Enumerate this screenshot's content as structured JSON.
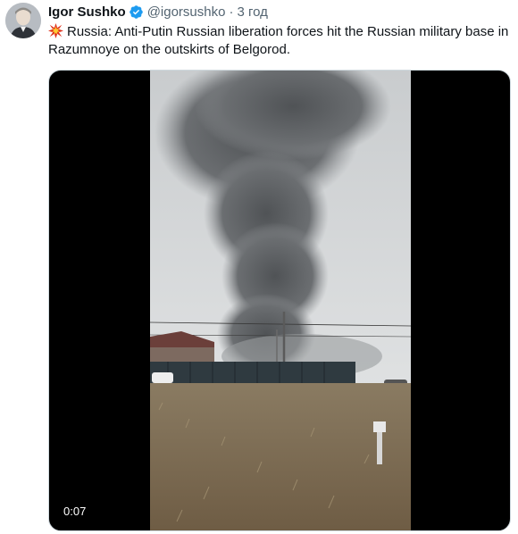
{
  "author": {
    "name": "Igor Sushko",
    "handle": "@igorsushko",
    "separator": "·",
    "time": "3 год",
    "verified": true
  },
  "tweet": {
    "emoji_icon": "collision-burst-icon",
    "text": "Russia: Anti-Putin Russian liberation forces hit the Russian military base in Razumnoye on the outskirts of Belgorod."
  },
  "media": {
    "type": "video",
    "duration": "0:07"
  },
  "colors": {
    "text": "#0f1419",
    "secondary": "#536471",
    "verified": "#1d9bf0",
    "media_border": "#cfd9de"
  }
}
